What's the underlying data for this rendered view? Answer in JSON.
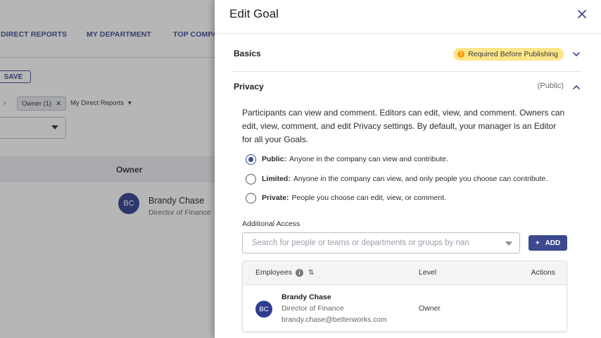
{
  "background": {
    "tabs": [
      "DIRECT REPORTS",
      "MY DEPARTMENT",
      "TOP COMPA"
    ],
    "save_label": "SAVE",
    "filter_chip": "Owner (1)",
    "filter_dropdown": "My Direct Reports",
    "table_header_owner": "Owner",
    "row": {
      "initials": "BC",
      "name": "Brandy Chase",
      "title": "Director of Finance"
    }
  },
  "drawer": {
    "title": "Edit Goal",
    "basics": {
      "label": "Basics",
      "badge": "Required Before Publishing",
      "badge_icon": "!"
    },
    "privacy": {
      "label": "Privacy",
      "status": "(Public)",
      "description": "Participants can view and comment. Editors can edit, view, and comment. Owners can edit, view, comment, and edit Privacy settings. By default, your manager is an Editor for all your Goals.",
      "options": [
        {
          "bold": "Public:",
          "text": "Anyone in the company can view and contribute.",
          "checked": true
        },
        {
          "bold": "Limited:",
          "text": "Anyone in the company can view, and only people you choose can contribute.",
          "checked": false
        },
        {
          "bold": "Private:",
          "text": "People you choose can edit, view, or comment.",
          "checked": false
        }
      ]
    },
    "additional_access": {
      "label": "Additional Access",
      "search_placeholder": "Search for people or teams or departments or groups by nan",
      "add_label": "ADD",
      "add_icon": "+"
    },
    "table": {
      "headers": {
        "employees": "Employees",
        "level": "Level",
        "actions": "Actions"
      },
      "sort_icon": "⇅",
      "info_icon": "i",
      "rows": [
        {
          "initials": "BC",
          "name": "Brandy Chase",
          "title": "Director of Finance",
          "email": "brandy.chase@betterworks.com",
          "level": "Owner"
        }
      ]
    }
  },
  "colors": {
    "primary": "#3b4a8f",
    "avatar": "#2f3d8f",
    "badge_bg": "#fde68a",
    "badge_dot": "#f59e0b"
  }
}
